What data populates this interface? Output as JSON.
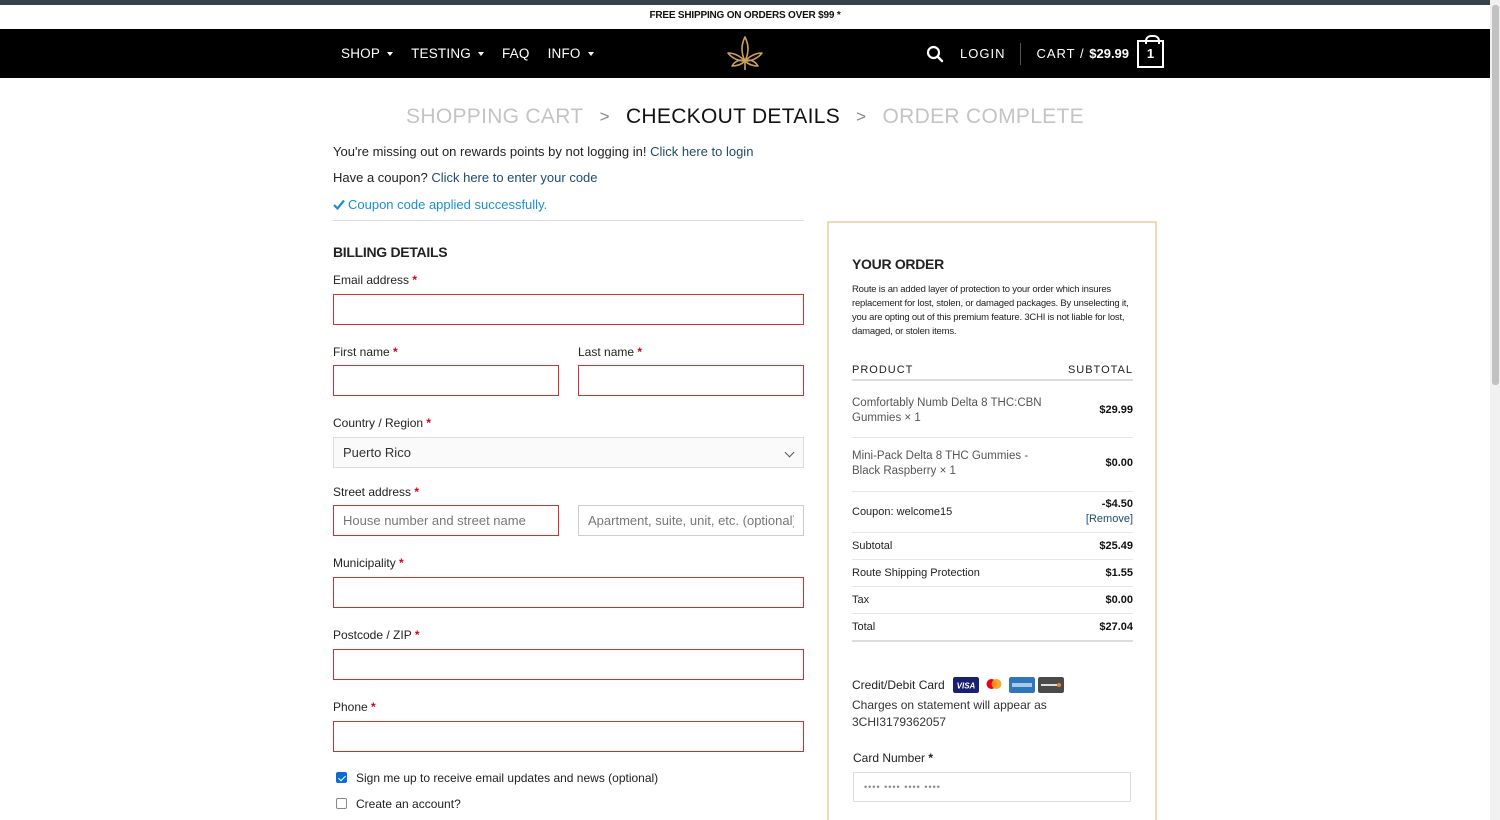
{
  "promo": {
    "text": "FREE SHIPPING ON ORDERS OVER $99 *"
  },
  "nav": {
    "items": [
      {
        "label": "SHOP",
        "dropdown": true
      },
      {
        "label": "TESTING",
        "dropdown": true
      },
      {
        "label": "FAQ",
        "dropdown": false
      },
      {
        "label": "INFO",
        "dropdown": true
      }
    ],
    "login": "LOGIN",
    "cart_prefix": "CART /",
    "cart_total": "$29.99",
    "cart_count": "1",
    "logo_icon": "cannabis-leaf-icon",
    "search_icon": "search-icon"
  },
  "steps": {
    "cart": "SHOPPING CART",
    "checkout": "CHECKOUT DETAILS",
    "complete": "ORDER COMPLETE",
    "separator": ">"
  },
  "notices": {
    "rewards_text": "You're missing out on rewards points by not logging in!",
    "rewards_link": "Click here to login",
    "coupon_text": "Have a coupon?",
    "coupon_link": "Click here to enter your code",
    "coupon_success": "Coupon code applied successfully."
  },
  "billing": {
    "title": "BILLING DETAILS",
    "email_label": "Email address",
    "first_name_label": "First name",
    "last_name_label": "Last name",
    "country_label": "Country / Region",
    "country_value": "Puerto Rico",
    "street_label": "Street address",
    "street_placeholder": "House number and street name",
    "apt_placeholder": "Apartment, suite, unit, etc. (optional)",
    "municipality_label": "Municipality",
    "postcode_label": "Postcode / ZIP",
    "phone_label": "Phone",
    "required_mark": "*",
    "signup_label": "Sign me up to receive email updates and news (optional)",
    "signup_checked": true,
    "create_account_label": "Create an account?",
    "create_account_checked": false
  },
  "order": {
    "title": "YOUR ORDER",
    "route_note": "Route is an added layer of protection to your order which insures replacement for lost, stolen, or damaged packages. By unselecting it, you are opting out of this premium feature. 3CHI is not liable for lost, damaged, or stolen items.",
    "col_product": "PRODUCT",
    "col_subtotal": "SUBTOTAL",
    "items": [
      {
        "name": "Comfortably Numb Delta 8 THC:CBN Gummies",
        "qty": "× 1",
        "amount": "$29.99"
      },
      {
        "name": "Mini-Pack Delta 8 THC Gummies - Black Raspberry",
        "qty": "× 1",
        "amount": "$0.00"
      }
    ],
    "coupon_label": "Coupon: welcome15",
    "coupon_amount": "-$4.50",
    "coupon_remove": "[Remove]",
    "subtotal_label": "Subtotal",
    "subtotal_amount": "$25.49",
    "route_label": "Route Shipping Protection",
    "route_amount": "$1.55",
    "tax_label": "Tax",
    "tax_amount": "$0.00",
    "total_label": "Total",
    "total_amount": "$27.04",
    "payment_title": "Credit/Debit Card",
    "payment_note": "Charges on statement will appear as 3CHI3179362057",
    "card_number_label": "Card Number",
    "card_number_placeholder": "•••• •••• •••• ••••",
    "card_brands": [
      "visa-icon",
      "mastercard-icon",
      "amex-icon",
      "discover-icon"
    ],
    "accent_color": "#f1d9b6",
    "error_color": "#d32f2f",
    "link_color": "#1e4c6c"
  }
}
